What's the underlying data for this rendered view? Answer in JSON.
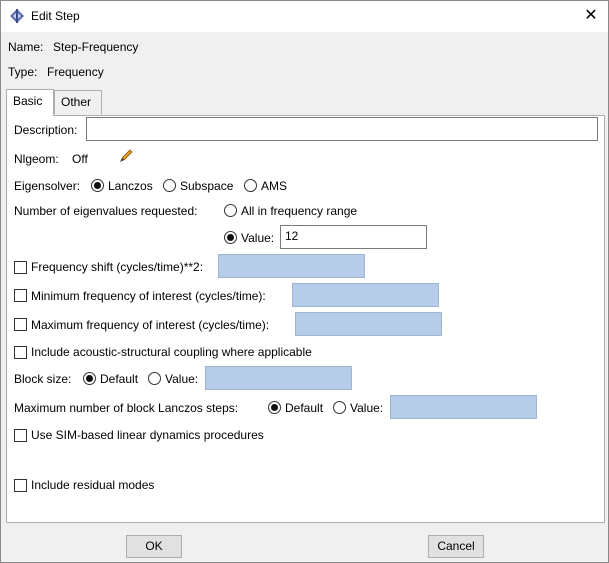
{
  "window": {
    "title": "Edit Step",
    "close_glyph": "✕"
  },
  "header": {
    "name_label": "Name:",
    "name_value": "Step-Frequency",
    "type_label": "Type:",
    "type_value": "Frequency"
  },
  "tabs": [
    {
      "label": "Basic"
    },
    {
      "label": "Other"
    }
  ],
  "basic": {
    "description_label": "Description:",
    "description_value": "",
    "nlgeom_label": "Nlgeom:",
    "nlgeom_value": "Off",
    "eigensolver_label": "Eigensolver:",
    "eigensolver_options": [
      "Lanczos",
      "Subspace",
      "AMS"
    ],
    "eigensolver_selected": "Lanczos",
    "num_eigen_label": "Number of eigenvalues requested:",
    "num_eigen_opt_all": "All in frequency range",
    "num_eigen_opt_value": "Value:",
    "num_eigen_value": "12",
    "freq_shift_label": "Frequency shift (cycles/time)**2:",
    "min_freq_label": "Minimum frequency of interest (cycles/time):",
    "max_freq_label": "Maximum frequency of interest (cycles/time):",
    "acoustic_label": "Include acoustic-structural coupling where applicable",
    "block_size_label": "Block size:",
    "block_size_default": "Default",
    "block_size_value": "Value:",
    "max_block_label": "Maximum number of block Lanczos steps:",
    "max_block_default": "Default",
    "max_block_value": "Value:",
    "sim_label": "Use SIM-based linear dynamics procedures",
    "residual_label": "Include residual modes"
  },
  "buttons": {
    "ok": "OK",
    "cancel": "Cancel"
  },
  "colors": {
    "disabled_field": "#b5cde8",
    "pencil": "#e8a020"
  }
}
